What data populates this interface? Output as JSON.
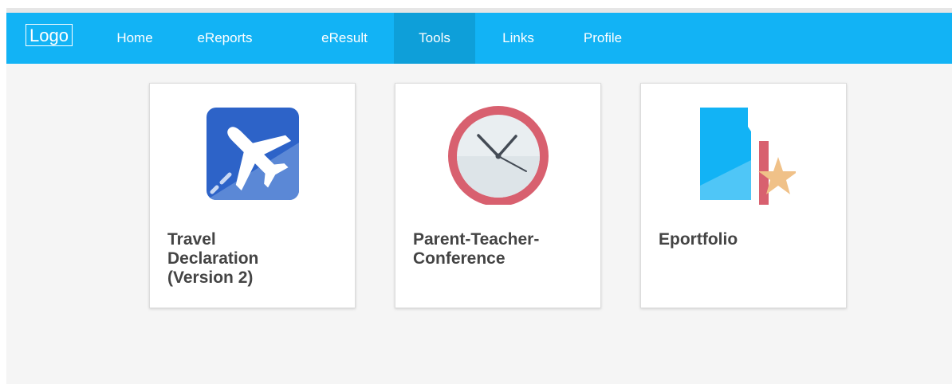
{
  "navbar": {
    "logo": "Logo",
    "items": [
      {
        "label": "Home",
        "active": false
      },
      {
        "label": "eReports",
        "active": false
      },
      {
        "label": "eResult",
        "active": false
      },
      {
        "label": "Tools",
        "active": true
      },
      {
        "label": "Links",
        "active": false
      },
      {
        "label": "Profile",
        "active": false
      }
    ],
    "color": "#12b3f5",
    "active_color": "#0e9fd9"
  },
  "tools": [
    {
      "title_lines": [
        "Travel",
        "Declaration",
        "(Version 2)"
      ],
      "icon": "airplane-icon"
    },
    {
      "title_lines": [
        "Parent-Teacher-",
        "Conference"
      ],
      "icon": "clock-icon"
    },
    {
      "title_lines": [
        "Eportfolio"
      ],
      "icon": "portfolio-star-icon"
    }
  ]
}
